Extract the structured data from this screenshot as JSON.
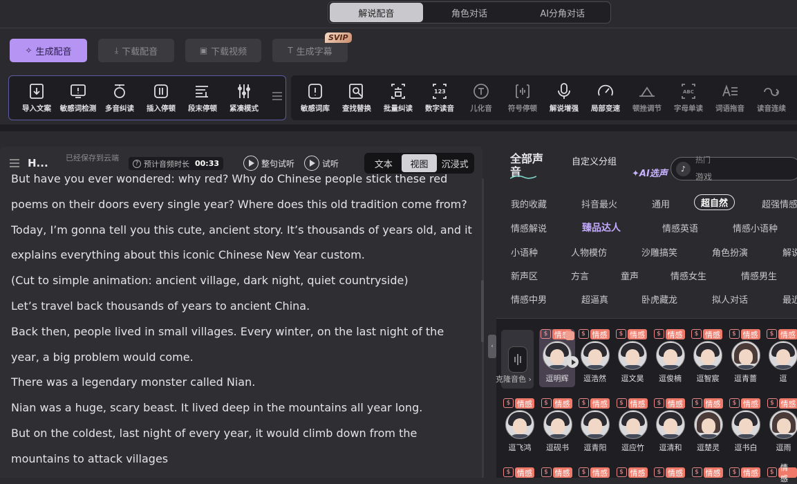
{
  "top_tabs": [
    {
      "label": "解说配音",
      "active": true
    },
    {
      "label": "角色对话",
      "active": false
    },
    {
      "label": "AI分角对话",
      "active": false
    }
  ],
  "actions": {
    "generate_voice": "生成配音",
    "download_voice": "下载配音",
    "download_video": "下载视频",
    "generate_subtitle": "生成字幕",
    "svip_badge": "SVIP"
  },
  "toolbar_left": [
    {
      "label": "导入文案",
      "icon": "import-icon"
    },
    {
      "label": "敏感词检测",
      "icon": "sensitive-check-icon"
    },
    {
      "label": "多音纠读",
      "icon": "polyphone-icon"
    },
    {
      "label": "插入停顿",
      "icon": "insert-pause-icon"
    },
    {
      "label": "段末停顿",
      "icon": "paragraph-pause-icon"
    },
    {
      "label": "紧凑模式",
      "icon": "compact-mode-icon"
    }
  ],
  "toolbar_right": [
    {
      "label": "敏感词库",
      "icon": "sensitive-lib-icon",
      "dim": false
    },
    {
      "label": "查找替换",
      "icon": "find-replace-icon",
      "dim": false
    },
    {
      "label": "批量纠读",
      "icon": "batch-correct-icon",
      "dim": false
    },
    {
      "label": "数字读音",
      "icon": "number-reading-icon",
      "dim": false
    },
    {
      "label": "儿化音",
      "icon": "erhua-icon",
      "dim": true
    },
    {
      "label": "符号停顿",
      "icon": "symbol-pause-icon",
      "dim": true
    },
    {
      "label": "解说增强",
      "icon": "mic-icon",
      "dim": false
    },
    {
      "label": "局部变速",
      "icon": "speedometer-icon",
      "dim": false
    },
    {
      "label": "顿挫调节",
      "icon": "cadence-icon",
      "dim": true
    },
    {
      "label": "字母单读",
      "icon": "letter-read-icon",
      "dim": true
    },
    {
      "label": "词语拖音",
      "icon": "drag-sound-icon",
      "dim": true
    },
    {
      "label": "读音连续",
      "icon": "continuous-icon",
      "dim": true
    }
  ],
  "editor": {
    "title": "H...",
    "save_status": "已经保存到云端",
    "duration_label": "预计音频时长",
    "duration_value": "00:33",
    "preview_sentence": "整句试听",
    "preview": "试听",
    "view_modes": [
      {
        "label": "文本",
        "active": false
      },
      {
        "label": "视图",
        "active": true
      },
      {
        "label": "沉浸式",
        "active": false
      }
    ],
    "lines": [
      "But have you ever wondered: why red? Why do Chinese people stick these red poems on their doors every single year? Where does this old tradition come from?",
      "Today, I’m gonna tell you this cute, ancient story. It’s thousands of years old, and it explains everything about this iconic Chinese New Year custom.",
      "(Cut to simple animation: ancient village, dark night, quiet countryside)",
      "Let’s travel back thousands of years to ancient China.",
      "Back then, people lived in small villages. Every winter, on the last night of the year, a big problem would come.",
      "There was a legendary monster called Nian.",
      "Nian was a huge, scary beast. It lived deep in the mountains all year long.",
      "But on the coldest, last night of every year, it would climb down from the mountains to attack villages"
    ]
  },
  "voice_panel": {
    "all_voices": "全部声音",
    "custom_category": "自定义分组",
    "ai_pick": "AI选声",
    "search_hint": "热门",
    "search_value": "游戏",
    "categories": [
      {
        "label": "我的收藏",
        "state": ""
      },
      {
        "label": "抖音最火",
        "state": ""
      },
      {
        "label": "通用",
        "state": ""
      },
      {
        "label": "超自然",
        "state": "sel"
      },
      {
        "label": "超强情感",
        "state": ""
      },
      {
        "label": "情感解说",
        "state": ""
      },
      {
        "label": "臻品达人",
        "state": "hl"
      },
      {
        "label": "情感英语",
        "state": ""
      },
      {
        "label": "情感小语种",
        "state": ""
      },
      {
        "label": "小语种",
        "state": ""
      },
      {
        "label": "人物模仿",
        "state": ""
      },
      {
        "label": "沙雕搞笑",
        "state": ""
      },
      {
        "label": "角色扮演",
        "state": ""
      },
      {
        "label": "解说",
        "state": ""
      },
      {
        "label": "新声区",
        "state": ""
      },
      {
        "label": "方言",
        "state": ""
      },
      {
        "label": "童声",
        "state": ""
      },
      {
        "label": "情感女生",
        "state": ""
      },
      {
        "label": "情感男生",
        "state": ""
      },
      {
        "label": "情感中男",
        "state": ""
      },
      {
        "label": "超逼真",
        "state": ""
      },
      {
        "label": "卧虎藏龙",
        "state": ""
      },
      {
        "label": "拟人对话",
        "state": ""
      },
      {
        "label": "最近",
        "state": ""
      }
    ],
    "clone_label": "克隆音色",
    "badge_s": "$",
    "badge_tag": "情感",
    "voices_row1": [
      {
        "name": "逗明辉",
        "featured": true,
        "fem": false
      },
      {
        "name": "逗浩然",
        "featured": false,
        "fem": false
      },
      {
        "name": "逗文昊",
        "featured": false,
        "fem": false
      },
      {
        "name": "逗俊楠",
        "featured": false,
        "fem": false
      },
      {
        "name": "逗智宸",
        "featured": false,
        "fem": false
      },
      {
        "name": "逗青蔷",
        "featured": false,
        "fem": true
      },
      {
        "name": "逗",
        "featured": false,
        "fem": false
      }
    ],
    "voices_row2": [
      {
        "name": "逗飞鸿",
        "featured": false,
        "fem": false
      },
      {
        "name": "逗砚书",
        "featured": false,
        "fem": false
      },
      {
        "name": "逗青阳",
        "featured": false,
        "fem": false
      },
      {
        "name": "逗应竹",
        "featured": false,
        "fem": false
      },
      {
        "name": "逗清和",
        "featured": false,
        "fem": false
      },
      {
        "name": "逗楚灵",
        "featured": false,
        "fem": true
      },
      {
        "name": "逗书白",
        "featured": false,
        "fem": false
      },
      {
        "name": "逗雨",
        "featured": false,
        "fem": true
      }
    ]
  }
}
